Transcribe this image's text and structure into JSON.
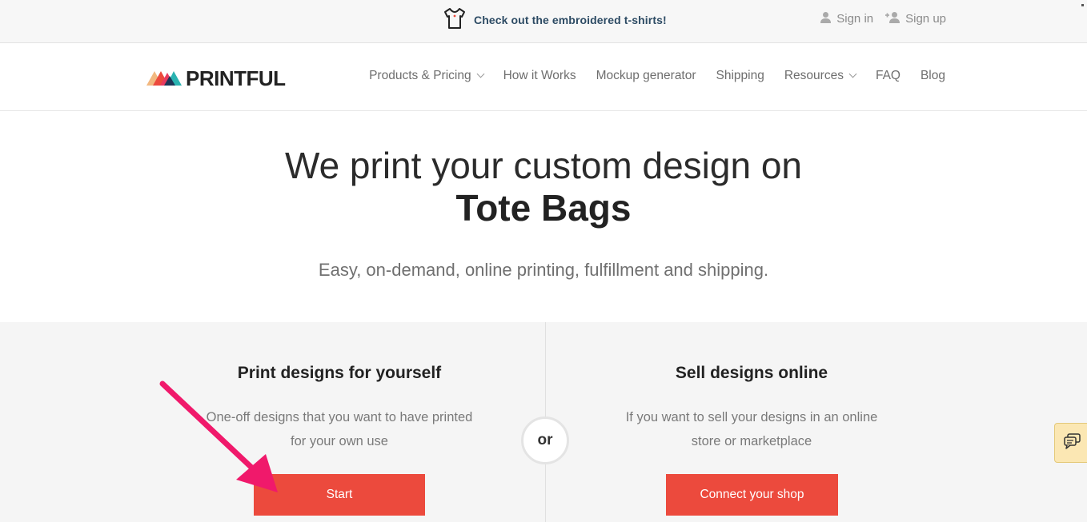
{
  "promo": {
    "text": "Check out the embroidered t-shirts!",
    "icon": "tshirt-icon"
  },
  "auth": {
    "sign_in": "Sign in",
    "sign_up": "Sign up"
  },
  "logo": {
    "text": "PRINTFUL"
  },
  "nav": {
    "items": [
      {
        "label": "Products & Pricing",
        "dropdown": true
      },
      {
        "label": "How it Works",
        "dropdown": false
      },
      {
        "label": "Mockup generator",
        "dropdown": false
      },
      {
        "label": "Shipping",
        "dropdown": false
      },
      {
        "label": "Resources",
        "dropdown": true
      },
      {
        "label": "FAQ",
        "dropdown": false
      },
      {
        "label": "Blog",
        "dropdown": false
      }
    ]
  },
  "hero": {
    "title": "We print your custom design on",
    "product": "Tote Bags",
    "subtitle": "Easy, on-demand, online printing, fulfillment and shipping."
  },
  "options": {
    "left": {
      "title": "Print designs for yourself",
      "desc_line1": "One-off designs that you want to have printed",
      "desc_line2": "for your own use",
      "button": "Start"
    },
    "or": "or",
    "right": {
      "title": "Sell designs online",
      "desc_line1": "If you want to sell your designs in an online",
      "desc_line2": "store or marketplace",
      "button": "Connect your shop"
    }
  },
  "colors": {
    "accent": "#ec4a3d",
    "promo_text": "#2d4b64",
    "annotation_arrow": "#f0196b",
    "chat_bg": "#fbe7b3"
  }
}
